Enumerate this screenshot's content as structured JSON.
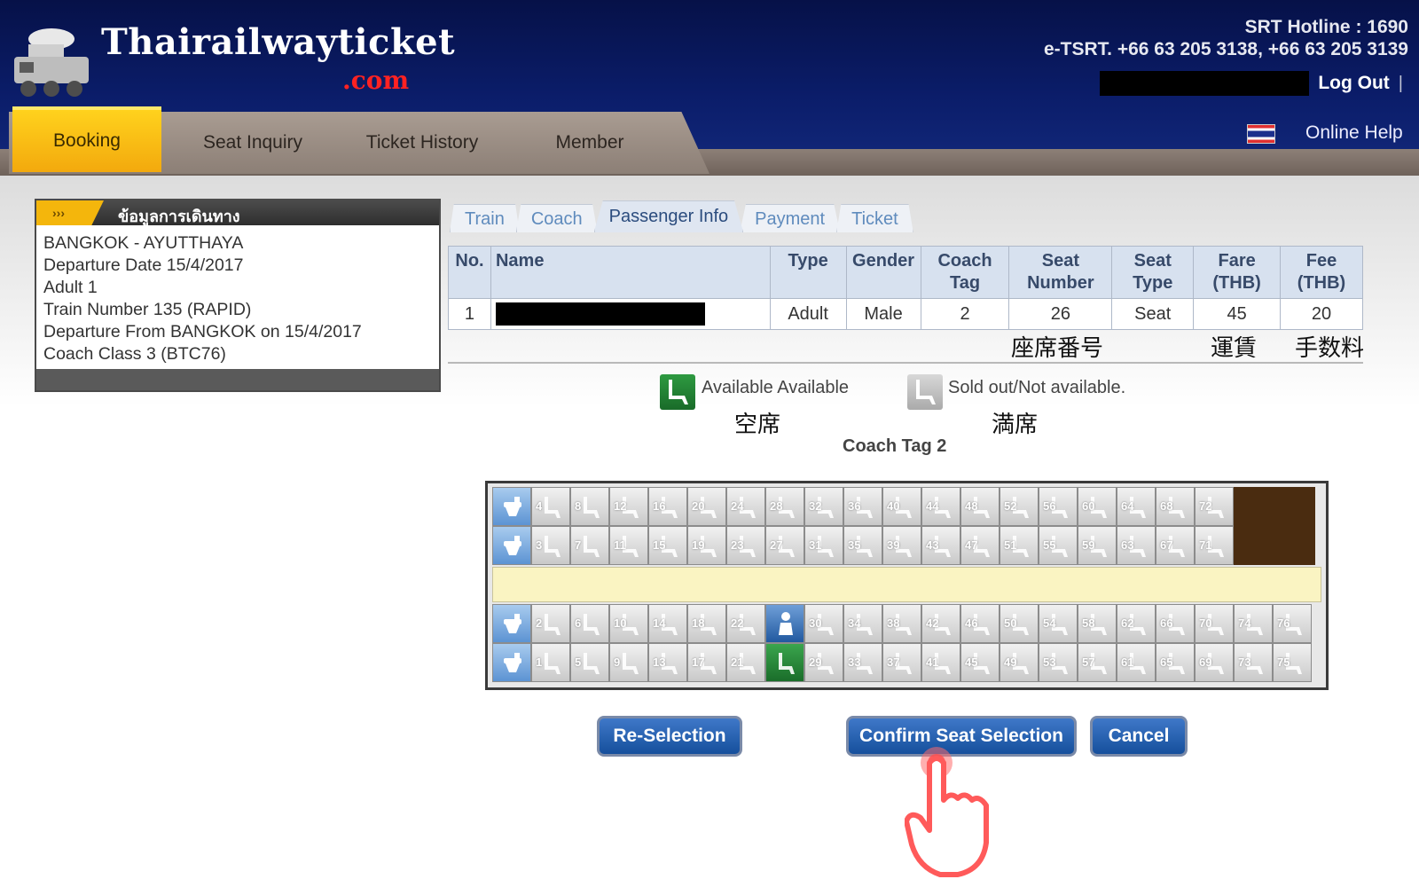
{
  "header": {
    "logo_main": "Thairailwayticket",
    "logo_sub": ".com",
    "hotline_line1": "SRT Hotline : 1690",
    "hotline_line2": "e-TSRT. +66 63 205 3138, +66 63 205 3139",
    "logout_label": "Log Out",
    "separator": "|",
    "online_help": "Online Help"
  },
  "nav": {
    "tabs": [
      {
        "label": "Booking",
        "active": true
      },
      {
        "label": "Seat Inquiry",
        "active": false
      },
      {
        "label": "Ticket History",
        "active": false
      },
      {
        "label": "Member",
        "active": false
      }
    ]
  },
  "journey": {
    "arrow": "›››",
    "title": "ข้อมูลการเดินทาง",
    "lines": [
      "BANGKOK - AYUTTHAYA",
      "Departure Date 15/4/2017",
      "Adult 1",
      "Train Number 135 (RAPID)",
      "Departure From BANGKOK on 15/4/2017",
      "Coach Class 3 (BTC76)"
    ]
  },
  "steps": [
    {
      "label": "Train",
      "active": false
    },
    {
      "label": "Coach",
      "active": false
    },
    {
      "label": "Passenger Info",
      "active": true
    },
    {
      "label": "Payment",
      "active": false
    },
    {
      "label": "Ticket",
      "active": false
    }
  ],
  "passenger_table": {
    "headers": {
      "no": "No.",
      "name": "Name",
      "type": "Type",
      "gender": "Gender",
      "coach_tag_1": "Coach",
      "coach_tag_2": "Tag",
      "seat_number_1": "Seat",
      "seat_number_2": "Number",
      "seat_type_1": "Seat",
      "seat_type_2": "Type",
      "fare_1": "Fare",
      "fare_2": "(THB)",
      "fee_1": "Fee",
      "fee_2": "(THB)"
    },
    "rows": [
      {
        "no": "1",
        "type": "Adult",
        "gender": "Male",
        "coach_tag": "2",
        "seat_number": "26",
        "seat_type": "Seat",
        "fare": "45",
        "fee": "20"
      }
    ]
  },
  "annotations": {
    "seat_number": "座席番号",
    "fare": "運賃",
    "fee": "手数料",
    "available": "空席",
    "sold_out": "満席"
  },
  "legend": {
    "available": "Available Available",
    "sold_out": "Sold out/Not available."
  },
  "seatmap": {
    "title": "Coach Tag 2",
    "row1": [
      "4",
      "8",
      "12",
      "16",
      "20",
      "24",
      "28",
      "32",
      "36",
      "40",
      "44",
      "48",
      "52",
      "56",
      "60",
      "64",
      "68",
      "72"
    ],
    "row2": [
      "3",
      "7",
      "11",
      "15",
      "19",
      "23",
      "27",
      "31",
      "35",
      "39",
      "43",
      "47",
      "51",
      "55",
      "59",
      "63",
      "67",
      "71"
    ],
    "row3": [
      "2",
      "6",
      "10",
      "14",
      "18",
      "22",
      "26",
      "30",
      "34",
      "38",
      "42",
      "46",
      "50",
      "54",
      "58",
      "62",
      "66",
      "70",
      "74",
      "76"
    ],
    "row4": [
      "1",
      "5",
      "9",
      "13",
      "17",
      "21",
      "25",
      "29",
      "33",
      "37",
      "41",
      "45",
      "49",
      "53",
      "57",
      "61",
      "65",
      "69",
      "73",
      "75"
    ],
    "selected_seat": "26",
    "available_seat": "25"
  },
  "buttons": {
    "reselect": "Re-Selection",
    "confirm": "Confirm Seat Selection",
    "cancel": "Cancel"
  },
  "colors": {
    "header_bg": "#0b1d6a",
    "active_tab": "#f3a90d",
    "button": "#1f5cae",
    "available": "#1a6d2a"
  }
}
